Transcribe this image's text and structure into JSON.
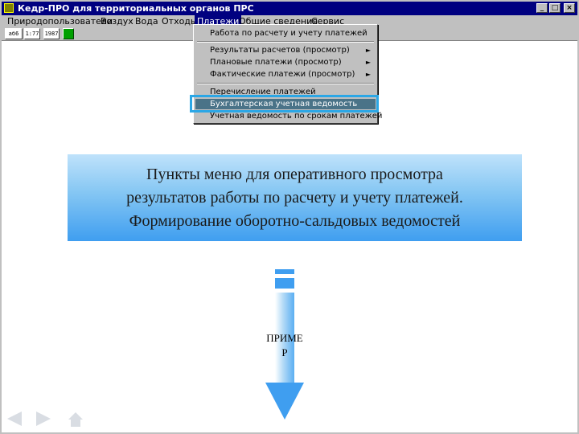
{
  "window": {
    "title": "Кедр-ПРО для территориальных органов ПРС",
    "buttons": [
      "_",
      "□",
      "×"
    ]
  },
  "menubar": {
    "items": [
      {
        "label": "Природопользователи"
      },
      {
        "label": "Воздух"
      },
      {
        "label": "Вода"
      },
      {
        "label": "Отходы"
      },
      {
        "label": "Платежи"
      },
      {
        "label": "Общие сведения"
      },
      {
        "label": "Сервис"
      }
    ]
  },
  "toolbar": {
    "buttons": [
      {
        "label": "аб6"
      },
      {
        "label": "1:77"
      },
      {
        "label": "1987"
      }
    ]
  },
  "dropdown": {
    "items": [
      {
        "label": "Работа по расчету и учету платежей",
        "submenu": false
      },
      {
        "label": "Результаты расчетов (просмотр)",
        "submenu": true
      },
      {
        "label": "Плановые платежи (просмотр)",
        "submenu": true
      },
      {
        "label": "Фактические платежи (просмотр)",
        "submenu": true
      },
      {
        "label": "Перечисление платежей",
        "submenu": false
      },
      {
        "label": "Бухгалтерская учетная ведомость",
        "submenu": false
      },
      {
        "label": "Учетная ведомость по срокам платежей",
        "submenu": false
      }
    ],
    "submenu_arrow": "►"
  },
  "callout": {
    "lines": [
      "Пункты меню для оперативного просмотра",
      "результатов работы по расчету и учету платежей.",
      "Формирование оборотно-сальдовых ведомостей"
    ]
  },
  "arrow": {
    "label_line1": "ПРИМЕ",
    "label_line2": "Р"
  },
  "colors": {
    "titlebar": "#000080",
    "menu_face": "#c0c0c0",
    "selected_item": "#4a7388",
    "highlight_frame": "#2ba7e6",
    "callout_blue": "#3f9ef0"
  }
}
